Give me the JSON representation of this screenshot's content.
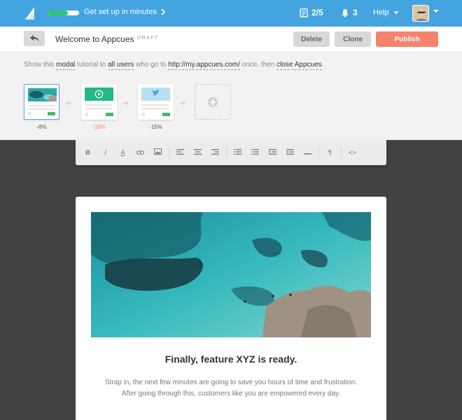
{
  "topbar": {
    "setup_label": "Get set up in minutes",
    "setup_progress": 0.65,
    "checklist_count": "2/5",
    "notifications_count": "3",
    "help_label": "Help"
  },
  "header": {
    "title": "Welcome to Appcues",
    "status": "DRAFT",
    "delete_label": "Delete",
    "clone_label": "Clone",
    "publish_label": "Publish"
  },
  "settings": {
    "s1": "Show this ",
    "type": "modal",
    "s2": " tutorial to ",
    "audience": "all users",
    "s3": " who go to ",
    "url": "http://my.appcues.com/",
    "s4": " once, then ",
    "action": "close Appcues",
    "s5": "."
  },
  "steps": [
    {
      "stat": "-8%",
      "thumb": "image"
    },
    {
      "stat": "-18%",
      "thumb": "video"
    },
    {
      "stat": "-15%",
      "thumb": "twitter"
    }
  ],
  "toolbar": [
    "bold-icon",
    "italic-icon",
    "font-color-icon",
    "link-icon",
    "image-icon",
    "align-left-icon",
    "align-center-icon",
    "align-right-icon",
    "ordered-list-icon",
    "unordered-list-icon",
    "outdent-icon",
    "indent-icon",
    "horizontal-rule-icon",
    "paragraph-icon",
    "code-icon"
  ],
  "modal": {
    "heading": "Finally, feature XYZ is ready.",
    "body_line1": "Strap in, the next few minutes are going to save you hours of time and frustration.",
    "body_line2": "After going through this, customers like you are empowered every day."
  },
  "colors": {
    "topbar": "#43a4e0",
    "publish": "#f4846e",
    "progress": "#2ec873",
    "accent_green": "#43b96d"
  }
}
